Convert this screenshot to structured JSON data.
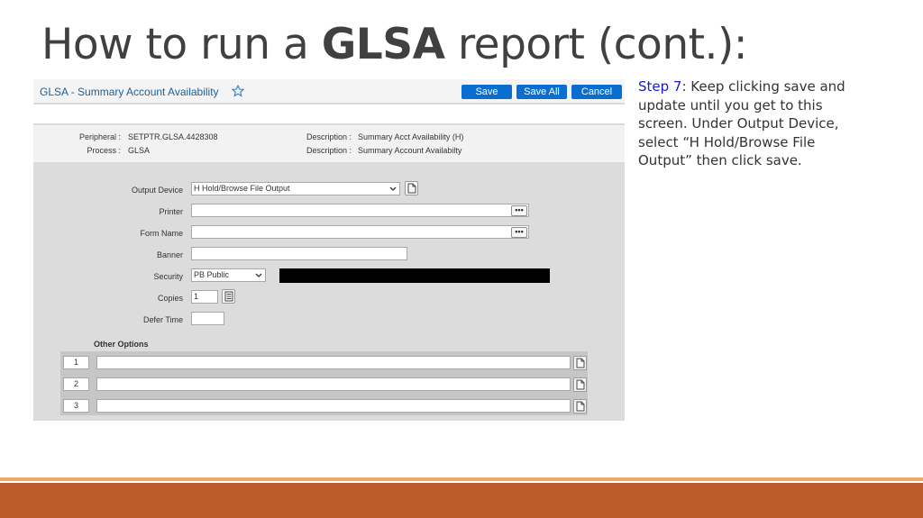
{
  "slide": {
    "title_prefix": "How to run a ",
    "title_bold": "GLSA",
    "title_suffix": " report (cont.):"
  },
  "app": {
    "title": "GLSA - Summary Account Availability",
    "buttons": {
      "save": "Save",
      "save_all": "Save All",
      "cancel": "Cancel"
    },
    "info": {
      "peripheral_label": "Peripheral :",
      "peripheral_value": "SETPTR.GLSA.4428308",
      "process_label": "Process :",
      "process_value": "GLSA",
      "desc1_label": "Description :",
      "desc1_value": "Summary Acct Availability (H)",
      "desc2_label": "Description :",
      "desc2_value": "Summary Account Availabilty"
    },
    "form": {
      "output_device_label": "Output Device",
      "output_device_value": "H Hold/Browse File Output",
      "printer_label": "Printer",
      "printer_value": "",
      "form_name_label": "Form Name",
      "form_name_value": "",
      "banner_label": "Banner",
      "banner_value": "",
      "security_label": "Security",
      "security_value": "PB Public",
      "copies_label": "Copies",
      "copies_value": "1",
      "defer_time_label": "Defer Time",
      "defer_time_value": ""
    },
    "other_options": {
      "title": "Other Options",
      "rows": [
        "1",
        "2",
        "3"
      ]
    }
  },
  "step": {
    "label": "Step 7",
    "text": ": Keep clicking save and update until you get to this screen.  Under Output Device, select “H Hold/Browse File Output” then click save."
  },
  "colors": {
    "accent_blue": "#0a6ed1",
    "step_label": "#1a1ac4",
    "footer_bar": "#bb5a2a",
    "footer_thin": "#e8a86a"
  }
}
